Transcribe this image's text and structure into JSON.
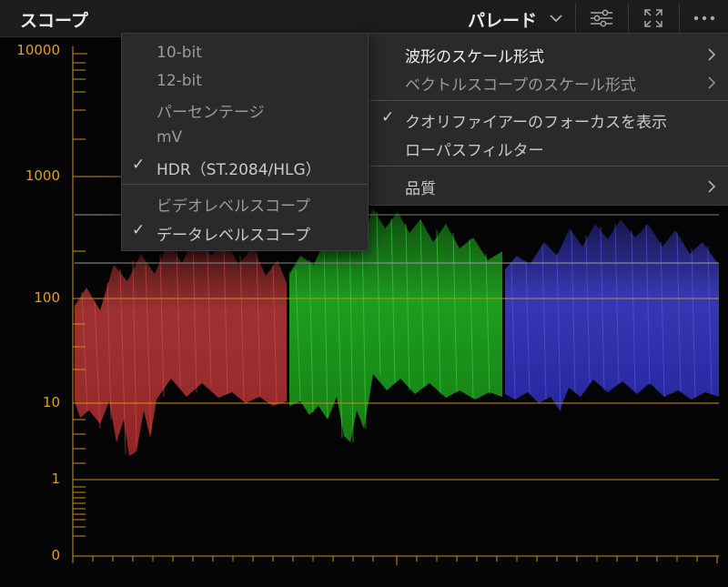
{
  "header": {
    "title": "スコープ",
    "mode_label": "パレード"
  },
  "scope": {
    "y_labels": [
      "10000",
      "1000",
      "100",
      "10",
      "1",
      "0"
    ],
    "axis_color": "#e0a020"
  },
  "menu_scale_units": {
    "items": [
      {
        "label": "10-bit",
        "checked": false
      },
      {
        "label": "12-bit",
        "checked": false
      },
      {
        "label": "パーセンテージ",
        "checked": false
      },
      {
        "label": "mV",
        "checked": false
      },
      {
        "label": "HDR（ST.2084/HLG）",
        "checked": true
      }
    ],
    "level_items": [
      {
        "label": "ビデオレベルスコープ",
        "checked": false
      },
      {
        "label": "データレベルスコープ",
        "checked": true
      }
    ]
  },
  "menu_options": {
    "waveform_scale": "波形のスケール形式",
    "vectorscope_scale": "ベクトルスコープのスケール形式",
    "show_qualifier_focus": "クオリファイアーのフォーカスを表示",
    "show_qualifier_focus_checked": true,
    "lowpass_filter": "ローパスフィルター",
    "quality": "品質"
  }
}
